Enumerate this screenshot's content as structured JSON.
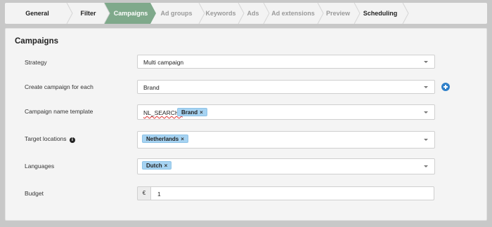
{
  "wizard": {
    "steps": [
      {
        "label": "General information",
        "state": "done"
      },
      {
        "label": "Filter",
        "state": "done"
      },
      {
        "label": "Campaigns",
        "state": "active"
      },
      {
        "label": "Ad groups",
        "state": "todo"
      },
      {
        "label": "Keywords",
        "state": "todo"
      },
      {
        "label": "Ads",
        "state": "todo"
      },
      {
        "label": "Ad extensions",
        "state": "todo"
      },
      {
        "label": "Preview",
        "state": "todo"
      },
      {
        "label": "Scheduling",
        "state": "done"
      }
    ],
    "colors": {
      "active": "#7fa98b",
      "inactive": "#f3f3f3",
      "divider": "#d6d6d6"
    }
  },
  "panel": {
    "title": "Campaigns",
    "strategy": {
      "label": "Strategy",
      "value": "Multi campaign"
    },
    "create_for_each": {
      "label": "Create campaign for each",
      "value": "Brand"
    },
    "name_template": {
      "label": "Campaign name template",
      "text": "NL_SEARCH_",
      "tag": "Brand"
    },
    "target_locations": {
      "label": "Target locations",
      "tag": "Netherlands"
    },
    "languages": {
      "label": "Languages",
      "tag": "Dutch"
    },
    "budget": {
      "label": "Budget",
      "currency": "€",
      "value": "1"
    }
  },
  "icons": {
    "add": "plus-circle-icon",
    "info": "info-icon",
    "remove": "×",
    "caret": "chevron-down-icon"
  },
  "colors": {
    "accent_blue": "#2f80c9",
    "tag_bg": "#a6d3f2"
  }
}
